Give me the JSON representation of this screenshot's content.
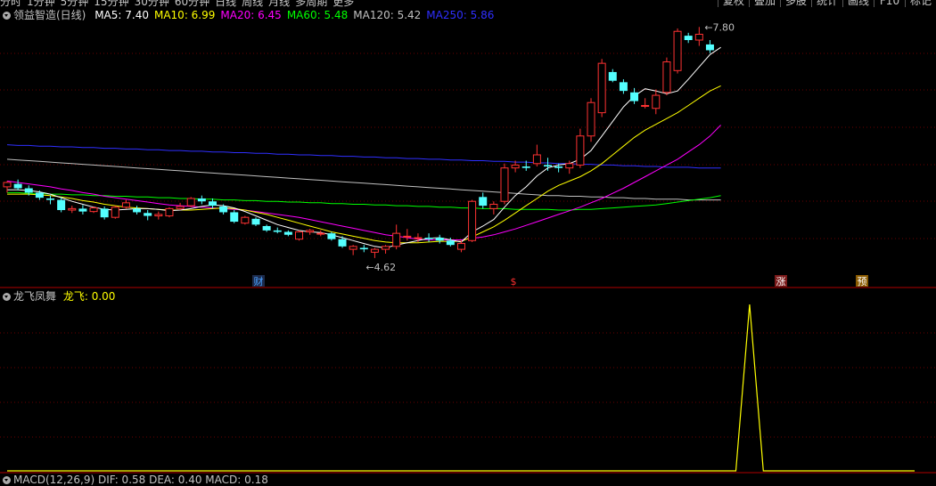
{
  "topbar": {
    "tabs": [
      "分时",
      "1分钟",
      "5分钟",
      "15分钟",
      "30分钟",
      "60分钟",
      "日线",
      "周线",
      "月线",
      "多周期",
      "更多"
    ],
    "buttons": [
      "复权",
      "叠加",
      "多股",
      "统计",
      "画线",
      "F10",
      "标记"
    ]
  },
  "main_legend": {
    "title": "领益智造(日线)",
    "ma": [
      {
        "label": "MA5: 7.40",
        "color": "#ffffff"
      },
      {
        "label": "MA10: 6.99",
        "color": "#ffff00"
      },
      {
        "label": "MA20: 6.45",
        "color": "#ff00ff"
      },
      {
        "label": "MA60: 5.48",
        "color": "#00ff00"
      },
      {
        "label": "MA120: 5.42",
        "color": "#c0c0c0"
      },
      {
        "label": "MA250: 5.86",
        "color": "#2f2fff"
      }
    ]
  },
  "annotations": {
    "high_label": "7.80",
    "low_label": "4.62",
    "markers": [
      {
        "text": "财",
        "color": "#4aa0ff",
        "bg": "#1c2a4a"
      },
      {
        "text": "$",
        "color": "#ff3030",
        "bg": "#000000"
      },
      {
        "text": "涨",
        "color": "#ffffff",
        "bg": "#7a1a1a"
      },
      {
        "text": "预",
        "color": "#ffffff",
        "bg": "#8a5a00"
      }
    ]
  },
  "indicator_legend": {
    "name": "龙飞凤舞",
    "line_label": "龙飞: 0.00",
    "line_color": "#ffff00"
  },
  "bottom_legend": {
    "text": "MACD(12,26,9) DIF: 0.58 DEA: 0.40 MACD: 0.18"
  },
  "chart_data": [
    {
      "type": "candlestick",
      "price_range": [
        4.3,
        8.0
      ],
      "candles": [
        {
          "o": 5.6,
          "h": 5.68,
          "l": 5.52,
          "c": 5.66
        },
        {
          "o": 5.64,
          "h": 5.7,
          "l": 5.55,
          "c": 5.58
        },
        {
          "o": 5.58,
          "h": 5.62,
          "l": 5.48,
          "c": 5.52
        },
        {
          "o": 5.52,
          "h": 5.55,
          "l": 5.42,
          "c": 5.45
        },
        {
          "o": 5.44,
          "h": 5.48,
          "l": 5.36,
          "c": 5.42
        },
        {
          "o": 5.42,
          "h": 5.46,
          "l": 5.25,
          "c": 5.28
        },
        {
          "o": 5.28,
          "h": 5.34,
          "l": 5.24,
          "c": 5.3
        },
        {
          "o": 5.3,
          "h": 5.35,
          "l": 5.22,
          "c": 5.26
        },
        {
          "o": 5.26,
          "h": 5.33,
          "l": 5.24,
          "c": 5.31
        },
        {
          "o": 5.3,
          "h": 5.33,
          "l": 5.15,
          "c": 5.18
        },
        {
          "o": 5.18,
          "h": 5.34,
          "l": 5.16,
          "c": 5.32
        },
        {
          "o": 5.32,
          "h": 5.42,
          "l": 5.3,
          "c": 5.38
        },
        {
          "o": 5.3,
          "h": 5.34,
          "l": 5.22,
          "c": 5.25
        },
        {
          "o": 5.24,
          "h": 5.28,
          "l": 5.14,
          "c": 5.2
        },
        {
          "o": 5.2,
          "h": 5.26,
          "l": 5.15,
          "c": 5.22
        },
        {
          "o": 5.2,
          "h": 5.32,
          "l": 5.18,
          "c": 5.3
        },
        {
          "o": 5.3,
          "h": 5.38,
          "l": 5.28,
          "c": 5.33
        },
        {
          "o": 5.34,
          "h": 5.46,
          "l": 5.32,
          "c": 5.44
        },
        {
          "o": 5.44,
          "h": 5.48,
          "l": 5.36,
          "c": 5.4
        },
        {
          "o": 5.4,
          "h": 5.44,
          "l": 5.3,
          "c": 5.34
        },
        {
          "o": 5.33,
          "h": 5.36,
          "l": 5.22,
          "c": 5.25
        },
        {
          "o": 5.25,
          "h": 5.28,
          "l": 5.1,
          "c": 5.12
        },
        {
          "o": 5.1,
          "h": 5.2,
          "l": 5.08,
          "c": 5.18
        },
        {
          "o": 5.16,
          "h": 5.18,
          "l": 5.06,
          "c": 5.08
        },
        {
          "o": 5.06,
          "h": 5.08,
          "l": 4.98,
          "c": 5.0
        },
        {
          "o": 5.0,
          "h": 5.04,
          "l": 4.96,
          "c": 4.98
        },
        {
          "o": 4.98,
          "h": 5.0,
          "l": 4.92,
          "c": 4.94
        },
        {
          "o": 4.88,
          "h": 5.0,
          "l": 4.86,
          "c": 4.98
        },
        {
          "o": 4.98,
          "h": 5.02,
          "l": 4.94,
          "c": 5.0
        },
        {
          "o": 4.96,
          "h": 5.0,
          "l": 4.92,
          "c": 4.96
        },
        {
          "o": 4.96,
          "h": 4.98,
          "l": 4.86,
          "c": 4.88
        },
        {
          "o": 4.88,
          "h": 4.92,
          "l": 4.76,
          "c": 4.78
        },
        {
          "o": 4.74,
          "h": 4.8,
          "l": 4.66,
          "c": 4.78
        },
        {
          "o": 4.76,
          "h": 4.8,
          "l": 4.7,
          "c": 4.74
        },
        {
          "o": 4.7,
          "h": 4.76,
          "l": 4.62,
          "c": 4.74
        },
        {
          "o": 4.74,
          "h": 4.8,
          "l": 4.68,
          "c": 4.78
        },
        {
          "o": 4.78,
          "h": 5.08,
          "l": 4.74,
          "c": 4.96
        },
        {
          "o": 4.92,
          "h": 5.02,
          "l": 4.86,
          "c": 4.92
        },
        {
          "o": 4.9,
          "h": 4.96,
          "l": 4.84,
          "c": 4.9
        },
        {
          "o": 4.9,
          "h": 4.96,
          "l": 4.84,
          "c": 4.88
        },
        {
          "o": 4.9,
          "h": 4.94,
          "l": 4.82,
          "c": 4.86
        },
        {
          "o": 4.86,
          "h": 4.9,
          "l": 4.78,
          "c": 4.8
        },
        {
          "o": 4.74,
          "h": 4.86,
          "l": 4.7,
          "c": 4.82
        },
        {
          "o": 4.86,
          "h": 5.42,
          "l": 4.84,
          "c": 5.4
        },
        {
          "o": 5.46,
          "h": 5.52,
          "l": 5.3,
          "c": 5.34
        },
        {
          "o": 5.3,
          "h": 5.4,
          "l": 5.22,
          "c": 5.36
        },
        {
          "o": 5.4,
          "h": 5.92,
          "l": 5.36,
          "c": 5.86
        },
        {
          "o": 5.86,
          "h": 5.96,
          "l": 5.8,
          "c": 5.9
        },
        {
          "o": 5.88,
          "h": 5.96,
          "l": 5.82,
          "c": 5.86
        },
        {
          "o": 5.92,
          "h": 6.18,
          "l": 5.88,
          "c": 6.04
        },
        {
          "o": 5.9,
          "h": 6.0,
          "l": 5.82,
          "c": 5.88
        },
        {
          "o": 5.88,
          "h": 5.92,
          "l": 5.8,
          "c": 5.86
        },
        {
          "o": 5.86,
          "h": 5.96,
          "l": 5.78,
          "c": 5.92
        },
        {
          "o": 5.9,
          "h": 6.4,
          "l": 5.86,
          "c": 6.3
        },
        {
          "o": 6.3,
          "h": 6.82,
          "l": 6.22,
          "c": 6.76
        },
        {
          "o": 6.62,
          "h": 7.36,
          "l": 6.56,
          "c": 7.3
        },
        {
          "o": 7.18,
          "h": 7.22,
          "l": 7.04,
          "c": 7.06
        },
        {
          "o": 7.04,
          "h": 7.08,
          "l": 6.88,
          "c": 6.92
        },
        {
          "o": 6.9,
          "h": 6.96,
          "l": 6.74,
          "c": 6.78
        },
        {
          "o": 6.72,
          "h": 6.82,
          "l": 6.68,
          "c": 6.72
        },
        {
          "o": 6.68,
          "h": 6.94,
          "l": 6.6,
          "c": 6.86
        },
        {
          "o": 6.9,
          "h": 7.38,
          "l": 6.86,
          "c": 7.32
        },
        {
          "o": 7.2,
          "h": 7.78,
          "l": 7.16,
          "c": 7.74
        },
        {
          "o": 7.68,
          "h": 7.72,
          "l": 7.58,
          "c": 7.62
        },
        {
          "o": 7.62,
          "h": 7.8,
          "l": 7.54,
          "c": 7.7
        },
        {
          "o": 7.56,
          "h": 7.62,
          "l": 7.44,
          "c": 7.48
        }
      ],
      "ma5": [
        5.56,
        5.56,
        5.55,
        5.53,
        5.5,
        5.45,
        5.4,
        5.36,
        5.32,
        5.29,
        5.28,
        5.29,
        5.3,
        5.3,
        5.29,
        5.27,
        5.28,
        5.3,
        5.33,
        5.35,
        5.34,
        5.31,
        5.26,
        5.2,
        5.14,
        5.08,
        5.04,
        5.0,
        4.98,
        4.97,
        4.94,
        4.9,
        4.86,
        4.82,
        4.78,
        4.76,
        4.8,
        4.83,
        4.86,
        4.89,
        4.9,
        4.87,
        4.84,
        4.98,
        5.06,
        5.15,
        5.32,
        5.48,
        5.6,
        5.75,
        5.86,
        5.9,
        5.92,
        5.98,
        6.1,
        6.3,
        6.5,
        6.7,
        6.85,
        6.95,
        6.92,
        6.88,
        6.92,
        7.08,
        7.25,
        7.42,
        7.52
      ],
      "ma10": [
        5.5,
        5.5,
        5.5,
        5.49,
        5.48,
        5.46,
        5.44,
        5.41,
        5.39,
        5.36,
        5.34,
        5.32,
        5.31,
        5.3,
        5.29,
        5.28,
        5.28,
        5.28,
        5.29,
        5.3,
        5.31,
        5.3,
        5.28,
        5.25,
        5.22,
        5.18,
        5.14,
        5.1,
        5.06,
        5.02,
        4.98,
        4.95,
        4.92,
        4.89,
        4.86,
        4.84,
        4.83,
        4.83,
        4.83,
        4.84,
        4.85,
        4.85,
        4.85,
        4.91,
        4.98,
        5.05,
        5.14,
        5.24,
        5.34,
        5.44,
        5.54,
        5.62,
        5.68,
        5.74,
        5.82,
        5.92,
        6.04,
        6.16,
        6.28,
        6.38,
        6.46,
        6.54,
        6.62,
        6.72,
        6.82,
        6.92,
        6.99
      ],
      "ma20": [
        5.68,
        5.66,
        5.64,
        5.62,
        5.6,
        5.57,
        5.55,
        5.52,
        5.5,
        5.47,
        5.45,
        5.43,
        5.41,
        5.39,
        5.37,
        5.35,
        5.34,
        5.33,
        5.32,
        5.31,
        5.3,
        5.29,
        5.28,
        5.26,
        5.24,
        5.22,
        5.2,
        5.18,
        5.15,
        5.12,
        5.09,
        5.06,
        5.03,
        5.0,
        4.97,
        4.94,
        4.92,
        4.9,
        4.88,
        4.87,
        4.87,
        4.87,
        4.87,
        4.89,
        4.91,
        4.94,
        4.98,
        5.02,
        5.07,
        5.12,
        5.17,
        5.22,
        5.27,
        5.32,
        5.38,
        5.44,
        5.51,
        5.58,
        5.66,
        5.74,
        5.82,
        5.9,
        5.98,
        6.08,
        6.18,
        6.3,
        6.45
      ],
      "ma60": [
        5.52,
        5.52,
        5.51,
        5.51,
        5.5,
        5.5,
        5.49,
        5.49,
        5.48,
        5.48,
        5.47,
        5.47,
        5.46,
        5.46,
        5.45,
        5.45,
        5.44,
        5.44,
        5.43,
        5.43,
        5.42,
        5.42,
        5.41,
        5.41,
        5.4,
        5.4,
        5.39,
        5.39,
        5.38,
        5.38,
        5.37,
        5.37,
        5.36,
        5.36,
        5.35,
        5.35,
        5.34,
        5.34,
        5.33,
        5.33,
        5.32,
        5.32,
        5.31,
        5.31,
        5.3,
        5.3,
        5.3,
        5.29,
        5.29,
        5.29,
        5.29,
        5.28,
        5.28,
        5.29,
        5.29,
        5.3,
        5.31,
        5.32,
        5.33,
        5.34,
        5.35,
        5.37,
        5.39,
        5.41,
        5.43,
        5.45,
        5.48
      ],
      "ma120": [
        5.98,
        5.97,
        5.96,
        5.95,
        5.94,
        5.93,
        5.92,
        5.91,
        5.9,
        5.89,
        5.88,
        5.87,
        5.86,
        5.85,
        5.84,
        5.83,
        5.82,
        5.81,
        5.8,
        5.79,
        5.78,
        5.77,
        5.76,
        5.75,
        5.74,
        5.73,
        5.72,
        5.71,
        5.7,
        5.69,
        5.68,
        5.67,
        5.66,
        5.65,
        5.64,
        5.63,
        5.62,
        5.61,
        5.6,
        5.59,
        5.58,
        5.57,
        5.56,
        5.55,
        5.54,
        5.53,
        5.52,
        5.51,
        5.5,
        5.49,
        5.48,
        5.48,
        5.47,
        5.47,
        5.46,
        5.46,
        5.45,
        5.45,
        5.44,
        5.44,
        5.43,
        5.43,
        5.43,
        5.42,
        5.42,
        5.42,
        5.42
      ],
      "ma250": [
        6.18,
        6.17,
        6.17,
        6.16,
        6.16,
        6.15,
        6.15,
        6.14,
        6.14,
        6.13,
        6.13,
        6.12,
        6.12,
        6.11,
        6.11,
        6.1,
        6.1,
        6.09,
        6.09,
        6.08,
        6.08,
        6.07,
        6.07,
        6.06,
        6.06,
        6.05,
        6.05,
        6.04,
        6.04,
        6.03,
        6.03,
        6.02,
        6.02,
        6.01,
        6.01,
        6.0,
        6.0,
        5.99,
        5.99,
        5.98,
        5.98,
        5.97,
        5.97,
        5.96,
        5.96,
        5.95,
        5.95,
        5.94,
        5.94,
        5.93,
        5.93,
        5.92,
        5.92,
        5.91,
        5.91,
        5.9,
        5.9,
        5.89,
        5.89,
        5.88,
        5.88,
        5.87,
        5.87,
        5.87,
        5.86,
        5.86,
        5.86
      ]
    },
    {
      "type": "line",
      "name": "龙飞",
      "ylim": [
        0,
        1
      ],
      "values_note_free": true,
      "values": [
        0,
        0,
        0,
        0,
        0,
        0,
        0,
        0,
        0,
        0,
        0,
        0,
        0,
        0,
        0,
        0,
        0,
        0,
        0,
        0,
        0,
        0,
        0,
        0,
        0,
        0,
        0,
        0,
        0,
        0,
        0,
        0,
        0,
        0,
        0,
        0,
        0,
        0,
        0,
        0,
        0,
        0,
        0,
        0,
        0,
        0,
        0,
        0,
        0,
        0,
        0,
        0,
        0,
        0,
        1,
        0,
        0,
        0,
        0,
        0,
        0,
        0,
        0,
        0,
        0,
        0,
        0
      ]
    }
  ]
}
